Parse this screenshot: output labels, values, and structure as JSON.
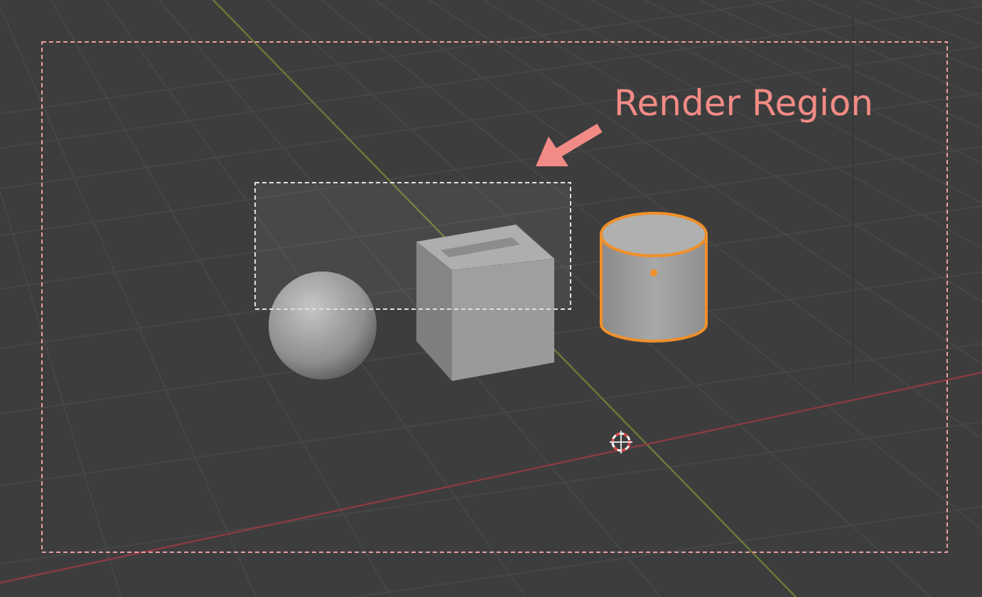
{
  "annotation": {
    "text": "Render Region"
  },
  "objects": [
    {
      "kind": "sphere",
      "selected": false
    },
    {
      "kind": "cube",
      "selected": false
    },
    {
      "kind": "cylinder",
      "selected": true
    }
  ]
}
